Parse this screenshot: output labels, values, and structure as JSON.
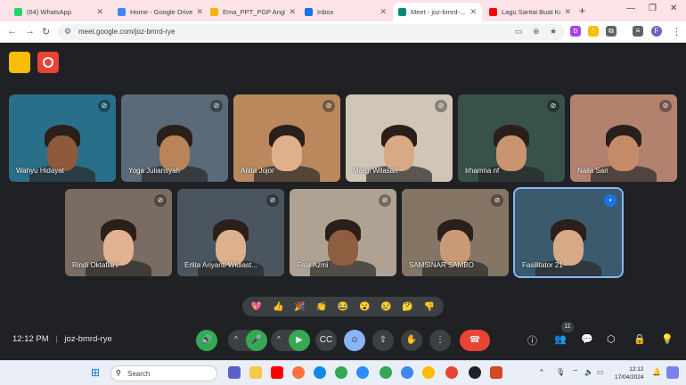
{
  "browser": {
    "tabs": [
      {
        "title": "(64) WhatsApp",
        "color": "#25d366"
      },
      {
        "title": "Home - Google Drive",
        "color": "#4285f4"
      },
      {
        "title": "Ema_PPT_PGP Angka...",
        "color": "#f4b400"
      },
      {
        "title": "Inbox",
        "color": "#1a73e8"
      },
      {
        "title": "Meet - joz-bmrd-...",
        "color": "#00897b"
      },
      {
        "title": "Lagu Santai Buat Ke...",
        "color": "#ff0000"
      }
    ],
    "url": "meet.google.com/joz-bmrd-rye"
  },
  "participants": [
    {
      "name": "Wahyu Hidayat",
      "bg": "#2a6f8a",
      "face": "#8d5a3b"
    },
    {
      "name": "Yoga Juliansyah",
      "bg": "#5b6a78",
      "face": "#b98558"
    },
    {
      "name": "Anita Jojor",
      "bg": "#b9895d",
      "face": "#e0b08d"
    },
    {
      "name": "Margi Wilasari",
      "bg": "#cfc6b6",
      "face": "#d9a985"
    },
    {
      "name": "Irhamna nf",
      "bg": "#38524a",
      "face": "#c9946f"
    },
    {
      "name": "Naila Sari",
      "bg": "#b2826f",
      "face": "#c58b67"
    },
    {
      "name": "Rindi Oktafiani",
      "bg": "#7a6c62",
      "face": "#e3b293"
    },
    {
      "name": "Erlita Ariyanti Widiast...",
      "bg": "#4a5560",
      "face": "#ddb08e"
    },
    {
      "name": "Fata Azmi",
      "bg": "#b0a293",
      "face": "#8f5d3f"
    },
    {
      "name": "SAMSINAR SAMBO",
      "bg": "#847564",
      "face": "#c99a75"
    },
    {
      "name": "Fasilitator 21",
      "bg": "#3c5a6e",
      "face": "#d7a987"
    }
  ],
  "reactions": [
    "💖",
    "👍",
    "🎉",
    "👏",
    "😂",
    "😮",
    "😢",
    "🤔",
    "👎"
  ],
  "meeting": {
    "time": "12:12 PM",
    "code": "joz-bmrd-rye",
    "people_count": "11"
  },
  "taskbar": {
    "search_placeholder": "Search",
    "time": "12:12",
    "date": "17/04/2024"
  },
  "colors": {
    "meet_bg": "#202124",
    "end_call": "#ea4335",
    "active_speaker": "#8ab4f8"
  }
}
